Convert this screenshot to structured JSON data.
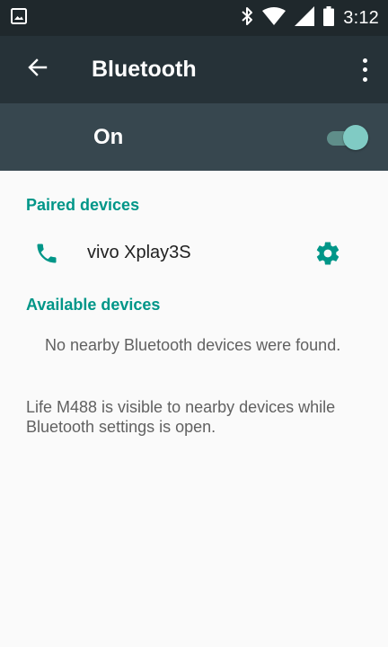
{
  "status_bar": {
    "time": "3:12",
    "icons": [
      "image-notification-icon",
      "bluetooth-icon",
      "wifi-icon",
      "signal-icon",
      "battery-icon"
    ]
  },
  "app_bar": {
    "title": "Bluetooth",
    "icons": [
      "back-arrow-icon",
      "overflow-menu-icon"
    ]
  },
  "toggle": {
    "label": "On",
    "state": "on"
  },
  "paired": {
    "header": "Paired devices",
    "devices": [
      {
        "name": "vivo Xplay3S",
        "icon": "phone-icon",
        "action_icon": "gear-icon"
      }
    ]
  },
  "available": {
    "header": "Available devices",
    "empty_message": "No nearby Bluetooth devices were found."
  },
  "footer": {
    "text": "Life M488 is visible to nearby devices while Bluetooth settings is open."
  },
  "colors": {
    "status_bar": "#1f282c",
    "app_bar": "#263238",
    "toggle_bar": "#37474f",
    "accent": "#009688",
    "switch_thumb": "#80cbc4",
    "background": "#fafafa"
  }
}
